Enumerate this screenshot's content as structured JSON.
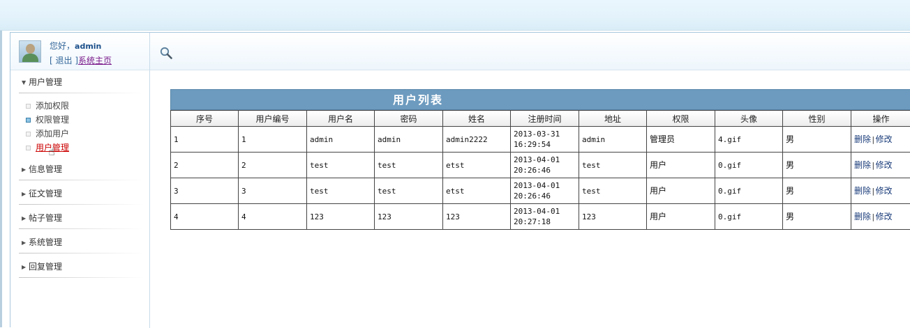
{
  "user": {
    "greeting": "您好，",
    "name": "admin",
    "logout_prefix": "[ ",
    "logout": "退出",
    "logout_suffix": " ]",
    "home": "系统主页"
  },
  "sidebar": {
    "groups": [
      {
        "title": "用户管理",
        "expanded": true,
        "items": [
          "添加权限",
          "权限管理",
          "添加用户",
          "用户管理"
        ]
      },
      {
        "title": "信息管理",
        "expanded": false
      },
      {
        "title": "征文管理",
        "expanded": false
      },
      {
        "title": "帖子管理",
        "expanded": false
      },
      {
        "title": "系统管理",
        "expanded": false
      },
      {
        "title": "回复管理",
        "expanded": false
      }
    ]
  },
  "icons": {
    "search": "search-icon",
    "avatar": "user-avatar"
  },
  "table": {
    "title": "用户列表",
    "headers": [
      "序号",
      "用户编号",
      "用户名",
      "密码",
      "姓名",
      "注册时间",
      "地址",
      "权限",
      "头像",
      "性别",
      "操作"
    ],
    "rows": [
      {
        "seq": "1",
        "id": "1",
        "username": "admin",
        "password": "admin",
        "name": "admin2222",
        "date": "2013-03-31",
        "time": "16:29:54",
        "address": "admin",
        "role": "管理员",
        "avatar": "4.gif",
        "gender": "男"
      },
      {
        "seq": "2",
        "id": "2",
        "username": "test",
        "password": "test",
        "name": "etst",
        "date": "2013-04-01",
        "time": "20:26:46",
        "address": "test",
        "role": "用户",
        "avatar": "0.gif",
        "gender": "男"
      },
      {
        "seq": "3",
        "id": "3",
        "username": "test",
        "password": "test",
        "name": "etst",
        "date": "2013-04-01",
        "time": "20:26:46",
        "address": "test",
        "role": "用户",
        "avatar": "0.gif",
        "gender": "男"
      },
      {
        "seq": "4",
        "id": "4",
        "username": "123",
        "password": "123",
        "name": "123",
        "date": "2013-04-01",
        "time": "20:27:18",
        "address": "123",
        "role": "用户",
        "avatar": "0.gif",
        "gender": "男"
      }
    ],
    "actions": {
      "delete": "删除",
      "separator": "|",
      "edit": "修改"
    }
  },
  "colors": {
    "table_title_bg": "#6d9bbf",
    "link": "#336699",
    "hover_red": "#cc0000"
  }
}
